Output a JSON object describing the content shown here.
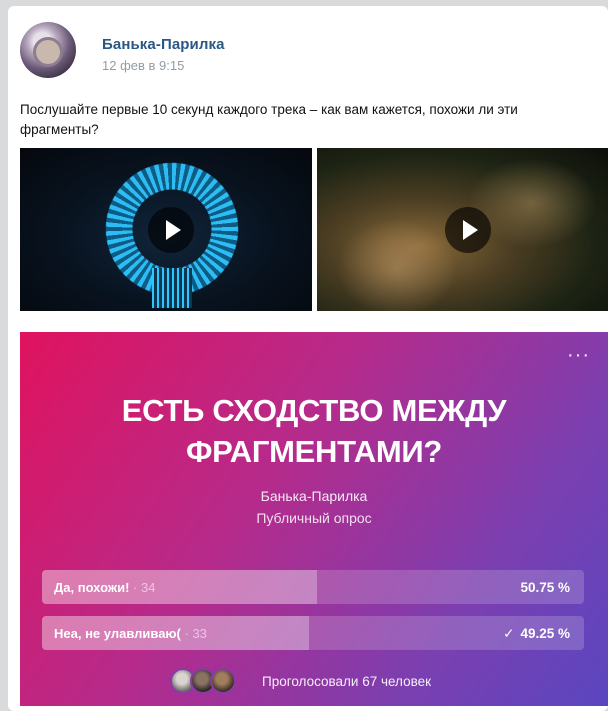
{
  "post": {
    "author": "Банька-Парилка",
    "date": "12 фев в 9:15",
    "text": "Послушайте первые 10 секунд каждого трека – как вам кажется, похожи ли эти фрагменты?"
  },
  "poll": {
    "more": "···",
    "title_line1": "ЕСТЬ СХОДСТВО МЕЖДУ",
    "title_line2": "ФРАГМЕНТАМИ?",
    "author": "Банька-Парилка",
    "type": "Публичный опрос",
    "options": [
      {
        "label": "Да, похожи!",
        "count": "· 34",
        "percent": "50.75 %",
        "share": 0.5075,
        "checked": false,
        "check": ""
      },
      {
        "label": "Неа, не улавливаю(",
        "count": "· 33",
        "percent": "49.25 %",
        "share": 0.4925,
        "checked": true,
        "check": "✓"
      }
    ],
    "voters_text": "Проголосовали 67 человек"
  },
  "colors": {
    "poll_gradient_start": "#e0135e",
    "poll_gradient_end": "#5a46c0",
    "author_link": "#2a5885"
  },
  "icons": {
    "play": "play-icon",
    "more": "more-icon",
    "check": "check-icon"
  }
}
